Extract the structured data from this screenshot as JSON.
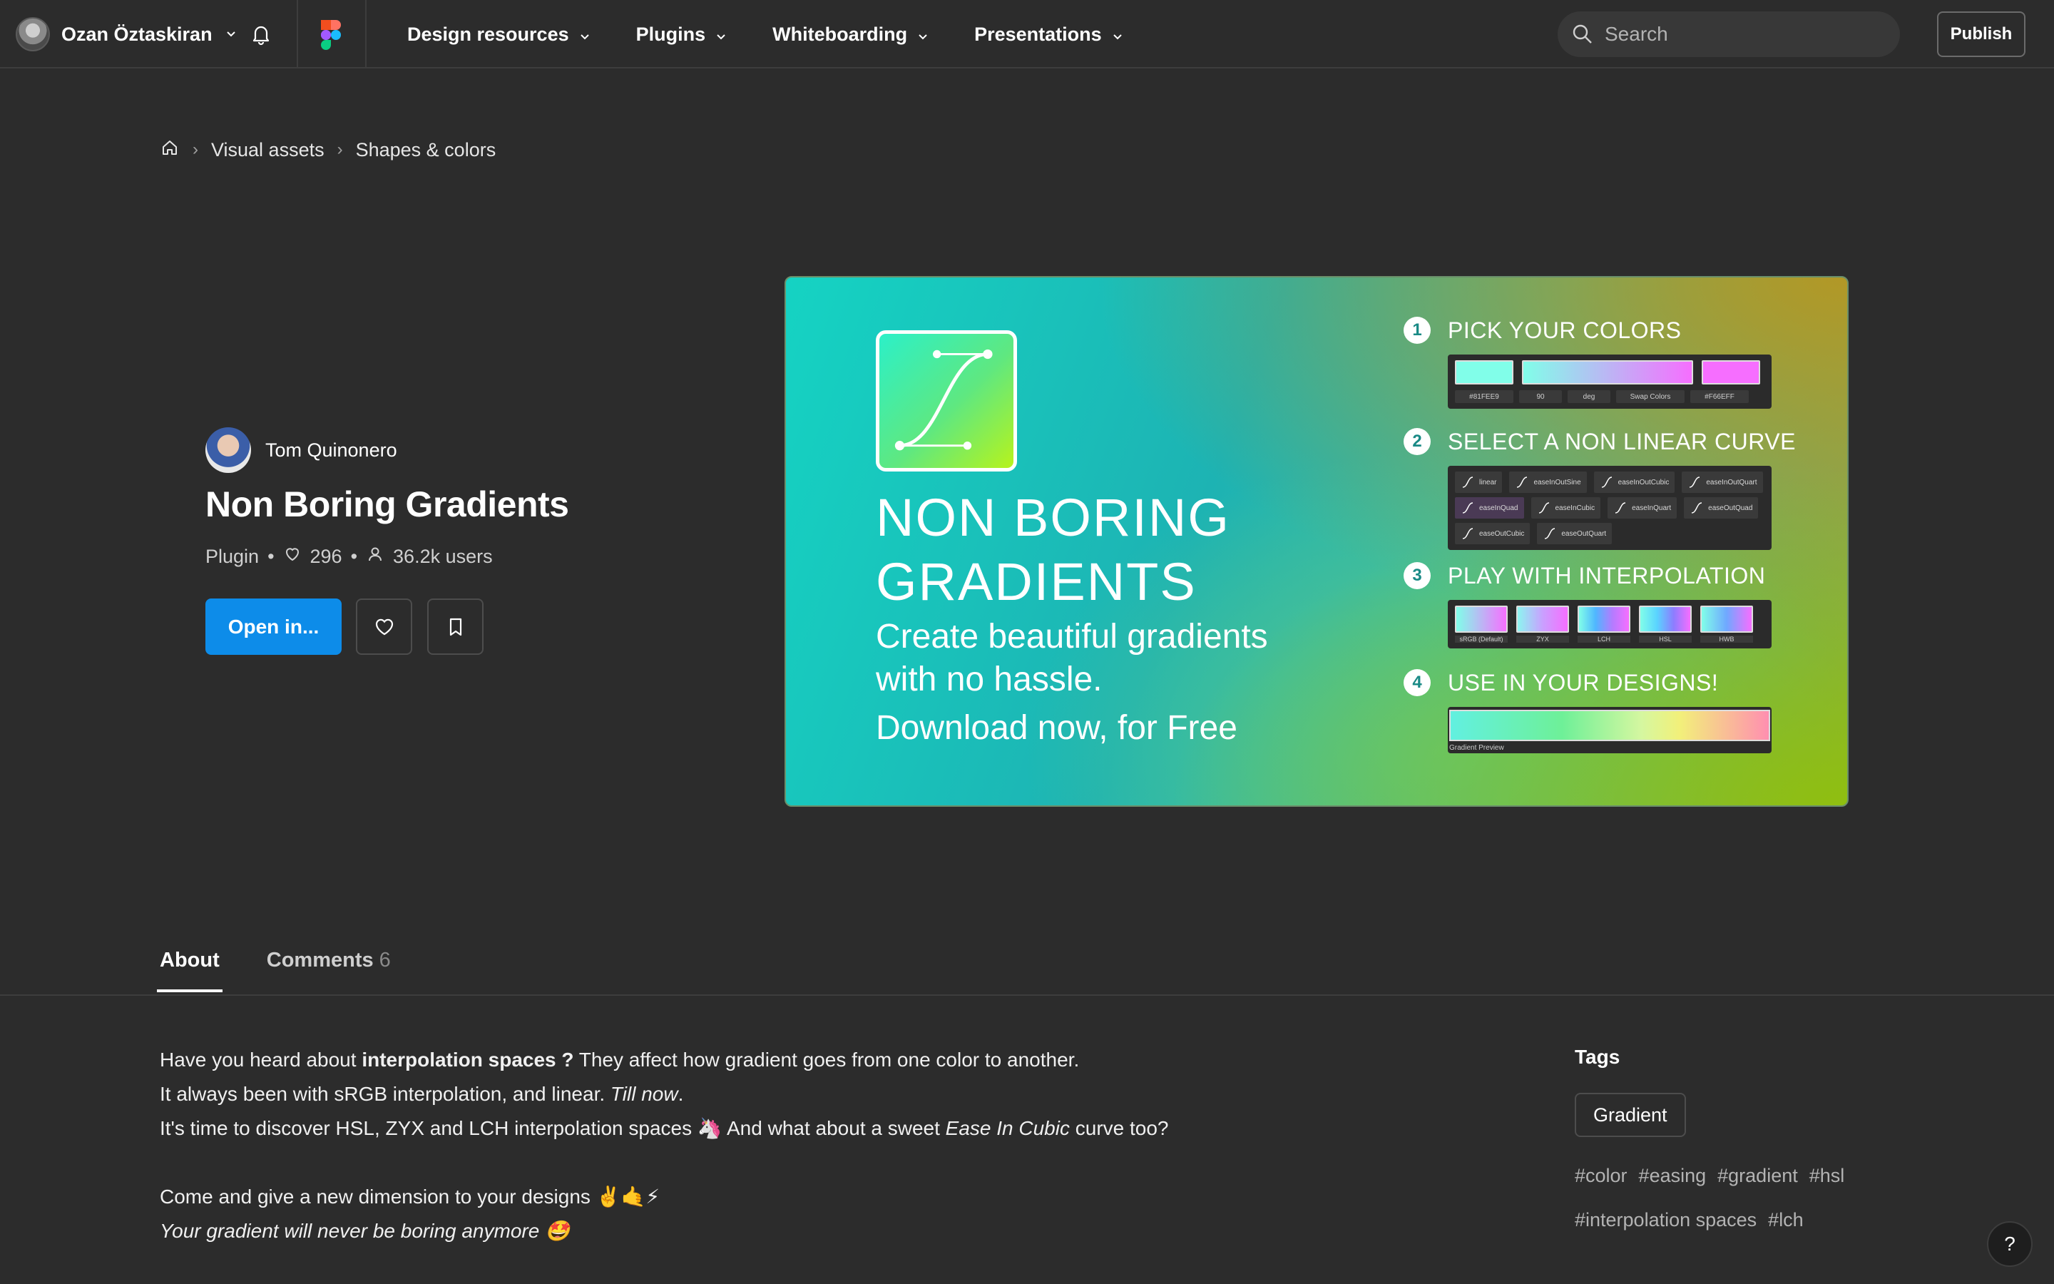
{
  "header": {
    "user_name": "Ozan Öztaskiran",
    "nav": [
      "Design resources",
      "Plugins",
      "Whiteboarding",
      "Presentations"
    ],
    "search_placeholder": "Search",
    "publish_label": "Publish"
  },
  "breadcrumb": [
    "Visual assets",
    "Shapes & colors"
  ],
  "plugin": {
    "author": "Tom Quinonero",
    "title": "Non Boring Gradients",
    "type": "Plugin",
    "likes": "296",
    "users": "36.2k users",
    "open_label": "Open in..."
  },
  "banner": {
    "title_line1": "NON BORING",
    "title_line2": "GRADIENTS",
    "subtitle_line1": "Create beautiful gradients",
    "subtitle_line2": "with no hassle.",
    "cta": "Download now, for Free",
    "steps": [
      {
        "num": "1",
        "label": "PICK YOUR COLORS"
      },
      {
        "num": "2",
        "label": "SELECT A NON LINEAR CURVE"
      },
      {
        "num": "3",
        "label": "PLAY WITH INTERPOLATION"
      },
      {
        "num": "4",
        "label": "USE IN YOUR DESIGNS!"
      }
    ],
    "color_controls": [
      "#81FEE9",
      "90",
      "deg",
      "Swap Colors",
      "#F66EFF"
    ],
    "curves": [
      "linear",
      "easeInOutSine",
      "easeInOutCubic",
      "easeInOutQuart",
      "easeInQuad",
      "easeInCubic",
      "easeInQuart",
      "easeOutQuad",
      "easeOutCubic",
      "easeOutQuart"
    ],
    "interpolations": [
      "sRGB (Default)",
      "ZYX",
      "LCH",
      "HSL",
      "HWB"
    ],
    "preview_label": "Gradient Preview"
  },
  "tabs": {
    "about": "About",
    "comments": "Comments",
    "comments_count": "6"
  },
  "about": {
    "p1_a": "Have you heard about ",
    "p1_b": "interpolation spaces ?",
    "p1_c": " They affect how gradient goes from one color to another.",
    "p2_a": "It always been with sRGB interpolation, and linear. ",
    "p2_b": "Till now",
    "p2_c": ".",
    "p3_a": "It's time to discover HSL, ZYX and LCH interpolation spaces 🦄 And what about a sweet ",
    "p3_b": "Ease In Cubic",
    "p3_c": " curve too?",
    "p4": "Come and give a new dimension to your designs ✌️🤙⚡",
    "p5": "Your gradient will never be boring anymore 🤩"
  },
  "tags": {
    "heading": "Tags",
    "chip": "Gradient",
    "hashtags": [
      "#color",
      "#easing",
      "#gradient",
      "#hsl",
      "#interpolation spaces",
      "#lch"
    ]
  },
  "help_label": "?"
}
